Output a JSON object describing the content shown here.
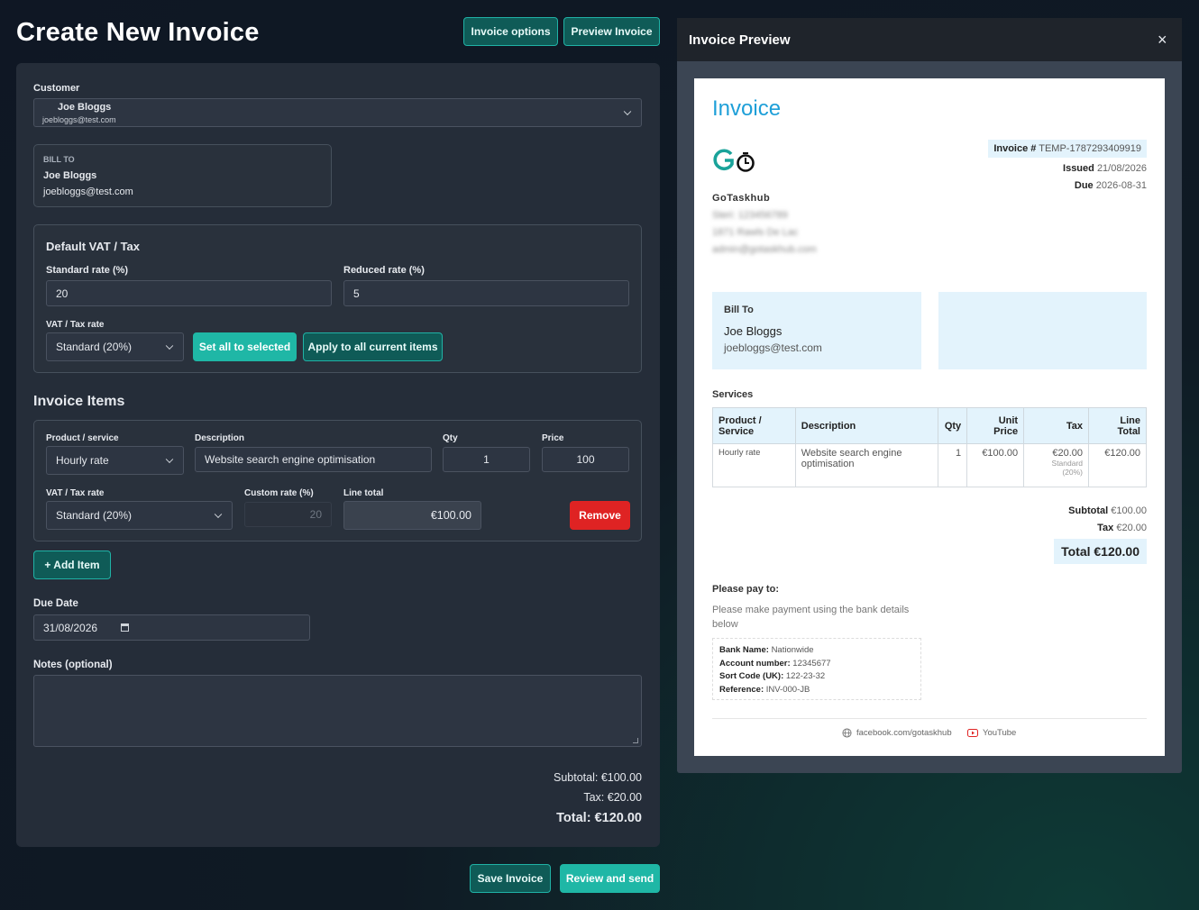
{
  "header": {
    "title": "Create New Invoice",
    "invoice_options": "Invoice options",
    "preview_invoice": "Preview Invoice"
  },
  "customer": {
    "label": "Customer",
    "name": "Joe Bloggs",
    "email": "joebloggs@test.com"
  },
  "bill_to_card": {
    "label": "BILL TO",
    "name": "Joe Bloggs",
    "email": "joebloggs@test.com"
  },
  "vat": {
    "title": "Default VAT / Tax",
    "standard_label": "Standard rate (%)",
    "standard_value": "20",
    "reduced_label": "Reduced rate (%)",
    "reduced_value": "5",
    "rate_label": "VAT / Tax rate",
    "rate_selected": "Standard (20%)",
    "set_all_btn": "Set all to selected",
    "apply_all_btn": "Apply to all current items"
  },
  "items_section": {
    "title": "Invoice Items",
    "product_label": "Product / service",
    "description_label": "Description",
    "qty_label": "Qty",
    "price_label": "Price",
    "vat_label": "VAT / Tax rate",
    "custom_rate_label": "Custom rate (%)",
    "line_total_label": "Line total",
    "items": [
      {
        "product": "Hourly rate",
        "description": "Website search engine optimisation",
        "qty": "1",
        "price": "100",
        "vat": "Standard (20%)",
        "custom_rate": "20",
        "line_total": "€100.00",
        "remove": "Remove"
      }
    ],
    "add_item": "+ Add Item"
  },
  "due_date": {
    "label": "Due Date",
    "value": "31/08/2026"
  },
  "notes": {
    "label": "Notes (optional)",
    "value": ""
  },
  "totals": {
    "subtotal": "Subtotal: €100.00",
    "tax": "Tax: €20.00",
    "total": "Total: €120.00"
  },
  "footer_buttons": {
    "save": "Save Invoice",
    "review": "Review and send"
  },
  "preview": {
    "panel_title": "Invoice Preview",
    "close": "×",
    "heading": "Invoice",
    "invoice_no_label": "Invoice #",
    "invoice_no": "TEMP-1787293409919",
    "issued_label": "Issued",
    "issued": "21/08/2026",
    "due_label": "Due",
    "due": "2026-08-31",
    "company": "GoTaskhub",
    "company_lines_blurred": [
      "Steri: 123456789",
      "1871 Rawls De Lac",
      "admin@gotaskhub.com"
    ],
    "bill_to_label": "Bill To",
    "bill_to_name": "Joe Bloggs",
    "bill_to_email": "joebloggs@test.com",
    "services_label": "Services",
    "columns": [
      "Product / Service",
      "Description",
      "Qty",
      "Unit Price",
      "Tax",
      "Line Total"
    ],
    "rows": [
      {
        "product": "Hourly rate",
        "description": "Website search engine optimisation",
        "qty": "1",
        "unit_price": "€100.00",
        "tax": "€20.00",
        "tax_note": "Standard (20%)",
        "line_total": "€120.00"
      }
    ],
    "subtotal_label": "Subtotal",
    "subtotal": "€100.00",
    "tax_label": "Tax",
    "tax": "€20.00",
    "total": "Total €120.00",
    "pay_to_label": "Please pay to:",
    "pay_instructions": "Please make payment using the bank details below",
    "bank": {
      "bank_name_label": "Bank Name:",
      "bank_name": "Nationwide",
      "account_label": "Account number:",
      "account": "12345677",
      "sort_label": "Sort Code (UK):",
      "sort": "122-23-32",
      "ref_label": "Reference:",
      "ref": "INV-000-JB"
    },
    "social_facebook": "facebook.com/gotaskhub",
    "social_youtube": "YouTube"
  },
  "colors": {
    "accent_teal": "#1fb7a6",
    "danger": "#e02424",
    "invoice_blue": "#1e9fd8"
  }
}
